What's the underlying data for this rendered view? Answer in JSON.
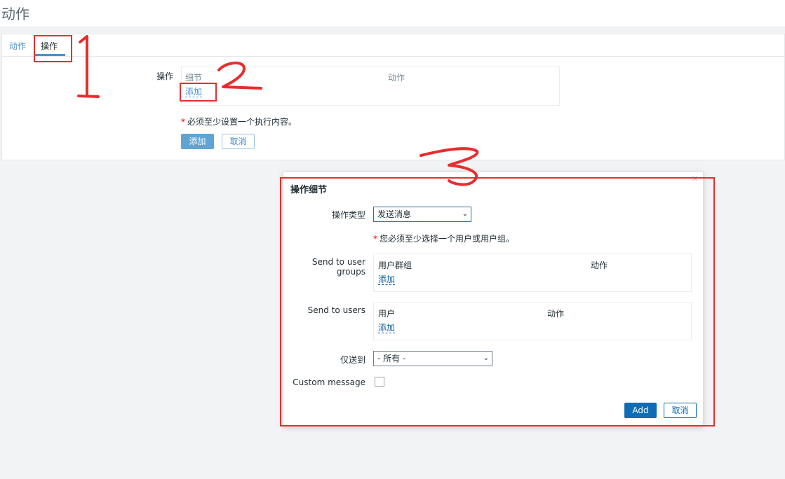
{
  "page": {
    "title": "动作"
  },
  "tabs": [
    {
      "label": "动作"
    },
    {
      "label": "操作"
    }
  ],
  "operations_form": {
    "label": "操作",
    "table_headers": {
      "details": "细节",
      "action": "动作"
    },
    "add_link": "添加",
    "required_note": "必须至少设置一个执行内容。",
    "add_button": "添加",
    "cancel_button": "取消"
  },
  "dialog": {
    "title": "操作细节",
    "close_glyph": "×",
    "operation_type_label": "操作类型",
    "operation_type_value": "发送消息",
    "required_note": "您必须至少选择一个用户或用户组。",
    "user_groups": {
      "label": "Send to user groups",
      "col_group": "用户群组",
      "col_action": "动作",
      "add_link": "添加"
    },
    "users": {
      "label": "Send to users",
      "col_user": "用户",
      "col_action": "动作",
      "add_link": "添加"
    },
    "send_only_to_label": "仅送到",
    "send_only_to_value": "- 所有 -",
    "custom_message_label": "Custom message",
    "custom_message_checked": false,
    "add_button": "Add",
    "cancel_button": "取消"
  },
  "icons": {
    "close": "close-icon",
    "dropdown": "chevron-down-icon"
  },
  "colors": {
    "link": "#0f5fa3",
    "primary": "#0e6db5",
    "annotation": "#e62e2e",
    "required": "#d40000"
  }
}
